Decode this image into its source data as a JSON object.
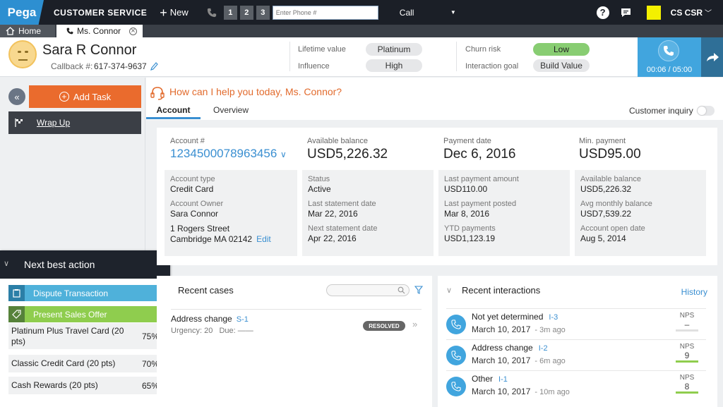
{
  "topbar": {
    "logo": "Pega",
    "app_name": "CUSTOMER SERVICE",
    "new_label": "New",
    "lines": [
      "1",
      "2",
      "3"
    ],
    "phone_placeholder": "Enter Phone #",
    "call_select": "Call",
    "help": "?",
    "user": "CS CSR"
  },
  "tabs": {
    "home": "Home",
    "customer": "Ms. Connor"
  },
  "customer": {
    "name": "Sara R Connor",
    "callback_label": "Callback #:",
    "callback_number": "617-374-9637"
  },
  "metrics": {
    "lifetime_value_label": "Lifetime value",
    "lifetime_value": "Platinum",
    "influence_label": "Influence",
    "influence": "High",
    "churn_risk_label": "Churn risk",
    "churn_risk": "Low",
    "interaction_goal_label": "Interaction goal",
    "interaction_goal": "Build Value"
  },
  "call": {
    "timer": "00:06 / 05:00"
  },
  "left": {
    "add_task": "Add Task",
    "wrap_up": "Wrap Up"
  },
  "nba": {
    "title": "Next best action",
    "actions": [
      "Dispute Transaction",
      "Present Sales Offer"
    ],
    "offers": [
      {
        "name": "Platinum Plus Travel Card (20 pts)",
        "pct": "75%"
      },
      {
        "name": "Classic Credit Card (20 pts)",
        "pct": "70%"
      },
      {
        "name": "Cash Rewards (20 pts)",
        "pct": "65%"
      }
    ]
  },
  "main": {
    "greeting": "How can I help you today, Ms. Connor?",
    "tabs": [
      "Account",
      "Overview"
    ],
    "inquiry_label": "Customer inquiry"
  },
  "account": {
    "number_label": "Account #",
    "number": "1234500078963456",
    "available_balance_label": "Available balance",
    "available_balance": "USD5,226.32",
    "payment_date_label": "Payment date",
    "payment_date": "Dec 6, 2016",
    "min_payment_label": "Min. payment",
    "min_payment": "USD95.00",
    "details": {
      "type_label": "Account type",
      "type": "Credit Card",
      "owner_label": "Account Owner",
      "owner": "Sara Connor",
      "address1": "1 Rogers Street",
      "address2": "Cambridge  MA  02142",
      "edit": "Edit",
      "status_label": "Status",
      "status": "Active",
      "last_stmt_label": "Last statement date",
      "last_stmt": "Mar 22, 2016",
      "next_stmt_label": "Next statement date",
      "next_stmt": "Apr 22, 2016",
      "last_amt_label": "Last payment amount",
      "last_amt": "USD110.00",
      "last_posted_label": "Last payment posted",
      "last_posted": "Mar 8, 2016",
      "ytd_label": "YTD payments",
      "ytd": "USD1,123.19",
      "avail_label": "Available balance",
      "avail": "USD5,226.32",
      "avg_label": "Avg monthly balance",
      "avg": "USD7,539.22",
      "open_label": "Account open date",
      "open": "Aug 5, 2014"
    }
  },
  "recent_cases": {
    "title": "Recent cases",
    "case_title": "Address change",
    "case_id": "S-1",
    "urgency": "Urgency: 20",
    "due": "Due:  ——",
    "status": "RESOLVED"
  },
  "recent_interactions": {
    "title": "Recent interactions",
    "history": "History",
    "nps_label": "NPS",
    "items": [
      {
        "title": "Not yet determined",
        "id": "I-3",
        "date": "March 10, 2017",
        "ago": "- 3m ago",
        "nps": "–"
      },
      {
        "title": "Address change",
        "id": "I-2",
        "date": "March 10, 2017",
        "ago": "- 6m ago",
        "nps": "9"
      },
      {
        "title": "Other",
        "id": "I-1",
        "date": "March 10, 2017",
        "ago": "- 10m ago",
        "nps": "8"
      }
    ]
  },
  "colors": {
    "brand_blue": "#2d8fd1",
    "orange": "#ea6b2d",
    "call_blue": "#41a5de",
    "nps_green": "#8fcd4e"
  }
}
